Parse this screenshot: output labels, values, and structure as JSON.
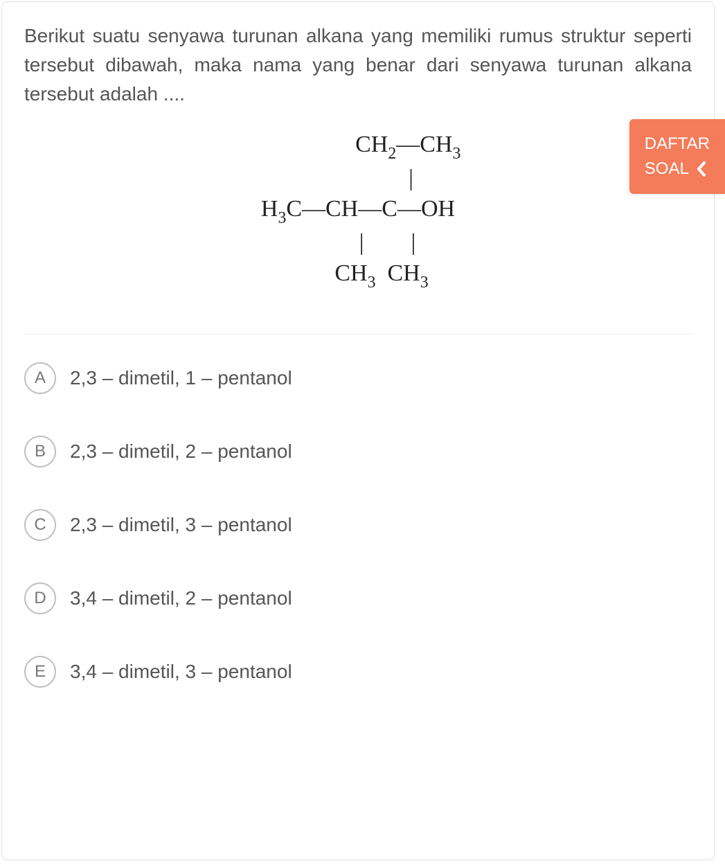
{
  "question": {
    "text": "Berikut suatu senyawa turunan alkana yang memiliki rumus struktur seperti tersebut dibawah, maka nama yang benar dari senyawa turunan alkana tersebut adalah ....",
    "structure": {
      "line1_left": "CH",
      "line1_bond": "—",
      "line1_right": "CH",
      "line2_prefix": "H",
      "line2_c": "C",
      "line2_bond": "—",
      "line2_ch": "CH",
      "line2_cc": "C",
      "line2_oh": "OH",
      "line3_left": "CH",
      "line3_right": "CH"
    }
  },
  "options": [
    {
      "letter": "A",
      "text": "2,3 – dimetil, 1 – pentanol"
    },
    {
      "letter": "B",
      "text": "2,3 – dimetil, 2 – pentanol"
    },
    {
      "letter": "C",
      "text": "2,3 – dimetil, 3 – pentanol"
    },
    {
      "letter": "D",
      "text": "3,4 – dimetil, 2 – pentanol"
    },
    {
      "letter": "E",
      "text": "3,4 – dimetil, 3 – pentanol"
    }
  ],
  "sideTab": {
    "line1": "DAFTAR",
    "line2": "SOAL"
  }
}
